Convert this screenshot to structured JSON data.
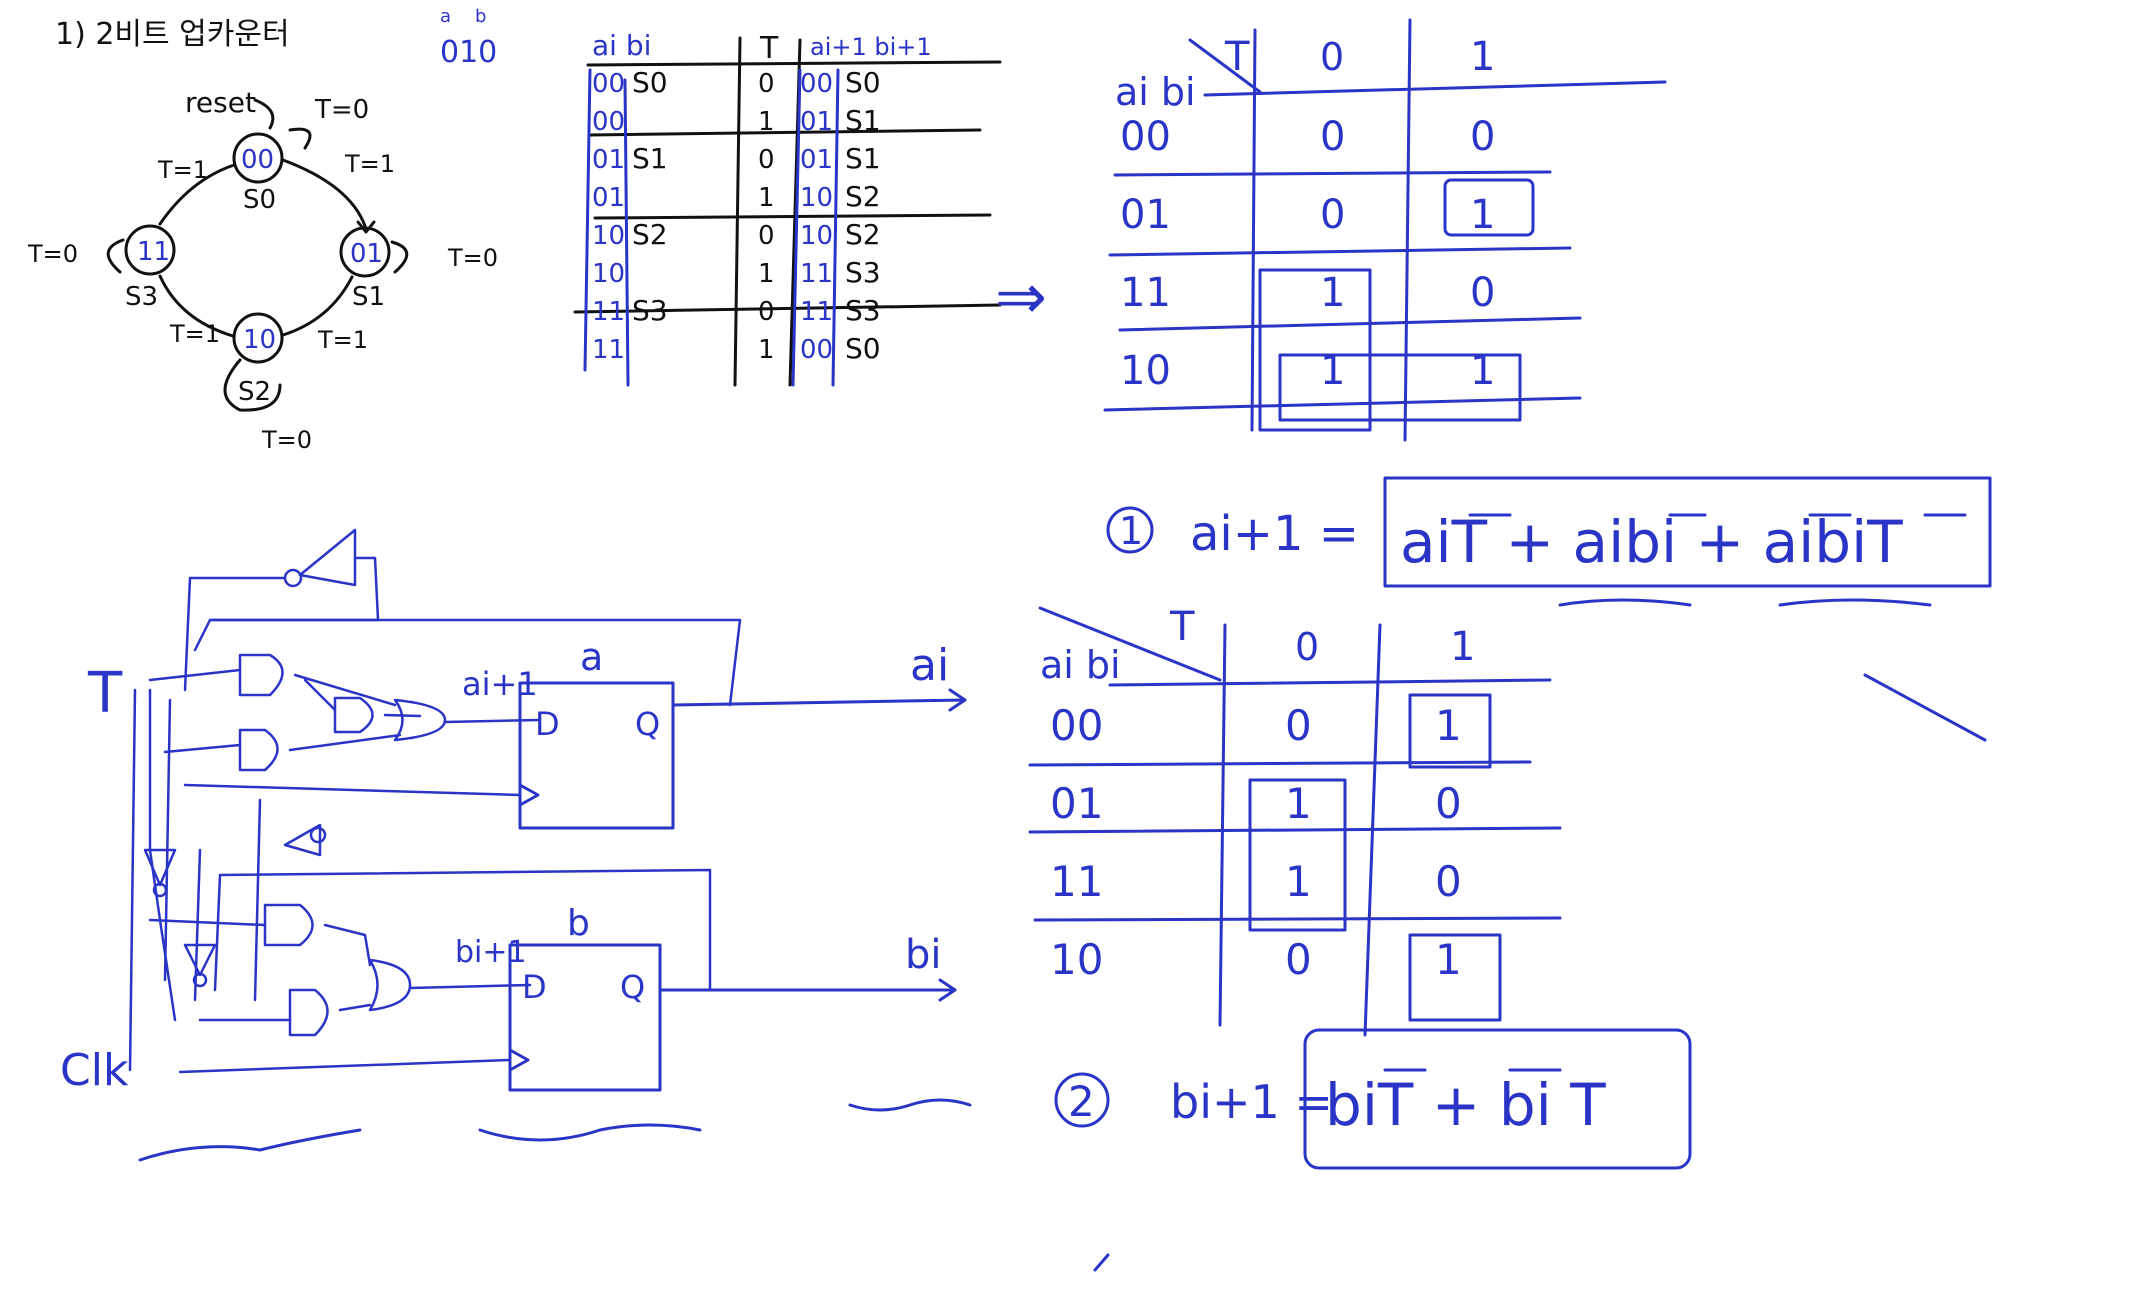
{
  "title": "1) 2비트 업카운터",
  "ab_note": {
    "a": "a",
    "b": "b",
    "digits": "010"
  },
  "colors": {
    "black_ink": "#111111",
    "blue_ink": "#2a34c6",
    "background": "#ffffff"
  },
  "state_diagram": {
    "reset": "reset",
    "states": [
      {
        "code": "00",
        "name": "S0",
        "self_loop": "T=0",
        "out": "T=1"
      },
      {
        "code": "01",
        "name": "S1",
        "self_loop": "T=0",
        "out": "T=1"
      },
      {
        "code": "10",
        "name": "S2",
        "self_loop": "T=0",
        "out": "T=1"
      },
      {
        "code": "11",
        "name": "S3",
        "self_loop": "T=0",
        "out": "T=1"
      }
    ],
    "reset_loop": "T=0"
  },
  "truth_table": {
    "headers": [
      "ai bi",
      "T",
      "ai+1 bi+1"
    ],
    "rows": [
      {
        "ab": "00",
        "state": "S0",
        "t": "0",
        "next": "00",
        "next_state": "S0"
      },
      {
        "ab": "00",
        "state": "",
        "t": "1",
        "next": "01",
        "next_state": "S1"
      },
      {
        "ab": "01",
        "state": "S1",
        "t": "0",
        "next": "01",
        "next_state": "S1"
      },
      {
        "ab": "01",
        "state": "",
        "t": "1",
        "next": "10",
        "next_state": "S2"
      },
      {
        "ab": "10",
        "state": "S2",
        "t": "0",
        "next": "10",
        "next_state": "S2"
      },
      {
        "ab": "10",
        "state": "",
        "t": "1",
        "next": "11",
        "next_state": "S3"
      },
      {
        "ab": "11",
        "state": "S3",
        "t": "0",
        "next": "11",
        "next_state": "S3"
      },
      {
        "ab": "11",
        "state": "",
        "t": "1",
        "next": "00",
        "next_state": "S0"
      }
    ]
  },
  "arrow": "⇒",
  "kmap_a": {
    "corner_row": "ai bi",
    "corner_col": "T",
    "cols": [
      "0",
      "1"
    ],
    "rows": [
      {
        "label": "00",
        "cells": [
          "0",
          "0"
        ]
      },
      {
        "label": "01",
        "cells": [
          "0",
          "1"
        ]
      },
      {
        "label": "11",
        "cells": [
          "1",
          "0"
        ]
      },
      {
        "label": "10",
        "cells": [
          "1",
          "1"
        ]
      }
    ]
  },
  "kmap_b": {
    "corner_row": "ai bi",
    "corner_col": "T",
    "cols": [
      "0",
      "1"
    ],
    "rows": [
      {
        "label": "00",
        "cells": [
          "0",
          "1"
        ]
      },
      {
        "label": "01",
        "cells": [
          "1",
          "0"
        ]
      },
      {
        "label": "11",
        "cells": [
          "1",
          "0"
        ]
      },
      {
        "label": "10",
        "cells": [
          "0",
          "1"
        ]
      }
    ]
  },
  "equation_1": {
    "num": "1",
    "lhs": "ai+1 =",
    "rhs": "aiT + aibi + aibiT"
  },
  "equation_2": {
    "num": "2",
    "lhs": "bi+1 =",
    "rhs": "biT + bi T"
  },
  "circuit": {
    "input_t": "T",
    "clock": "Clk",
    "ff_a": "a",
    "ff_b": "b",
    "d_label": "D",
    "q_label": "Q",
    "a_next": "ai+1",
    "b_next": "bi+1",
    "out_a": "ai",
    "out_b": "bi"
  }
}
